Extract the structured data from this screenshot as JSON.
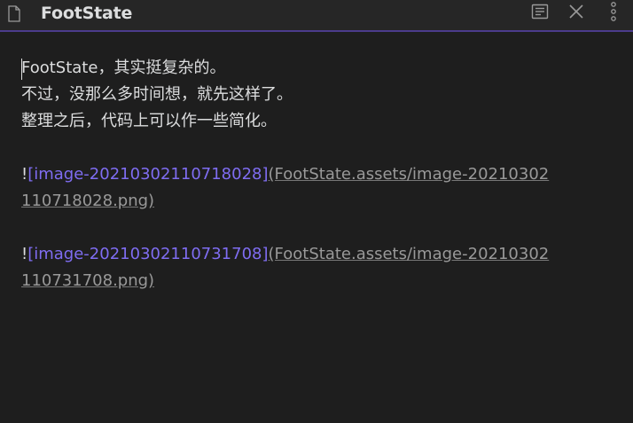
{
  "header": {
    "title": "FootState",
    "icons": {
      "file": "file-icon",
      "reading": "reading-view-icon",
      "close": "close-icon",
      "more": "more-options-icon"
    }
  },
  "editor": {
    "lines": [
      "FootState，其实挺复杂的。",
      "不过，没那么多时间想，就先这样了。",
      "整理之后，代码上可以作一些简化。"
    ],
    "images": [
      {
        "bang": "!",
        "alt": "[image-20210302110718028]",
        "url_part1": "(FootState.assets/image-20210302",
        "url_part2": "110718028.png)"
      },
      {
        "bang": "!",
        "alt": "[image-20210302110731708]",
        "url_part1": "(FootState.assets/image-20210302",
        "url_part2": "110731708.png)"
      }
    ]
  },
  "colors": {
    "background": "#1e1e1e",
    "titlebar": "#262626",
    "accent": "#7f6df2",
    "text": "#dcddde",
    "muted": "#999999"
  }
}
